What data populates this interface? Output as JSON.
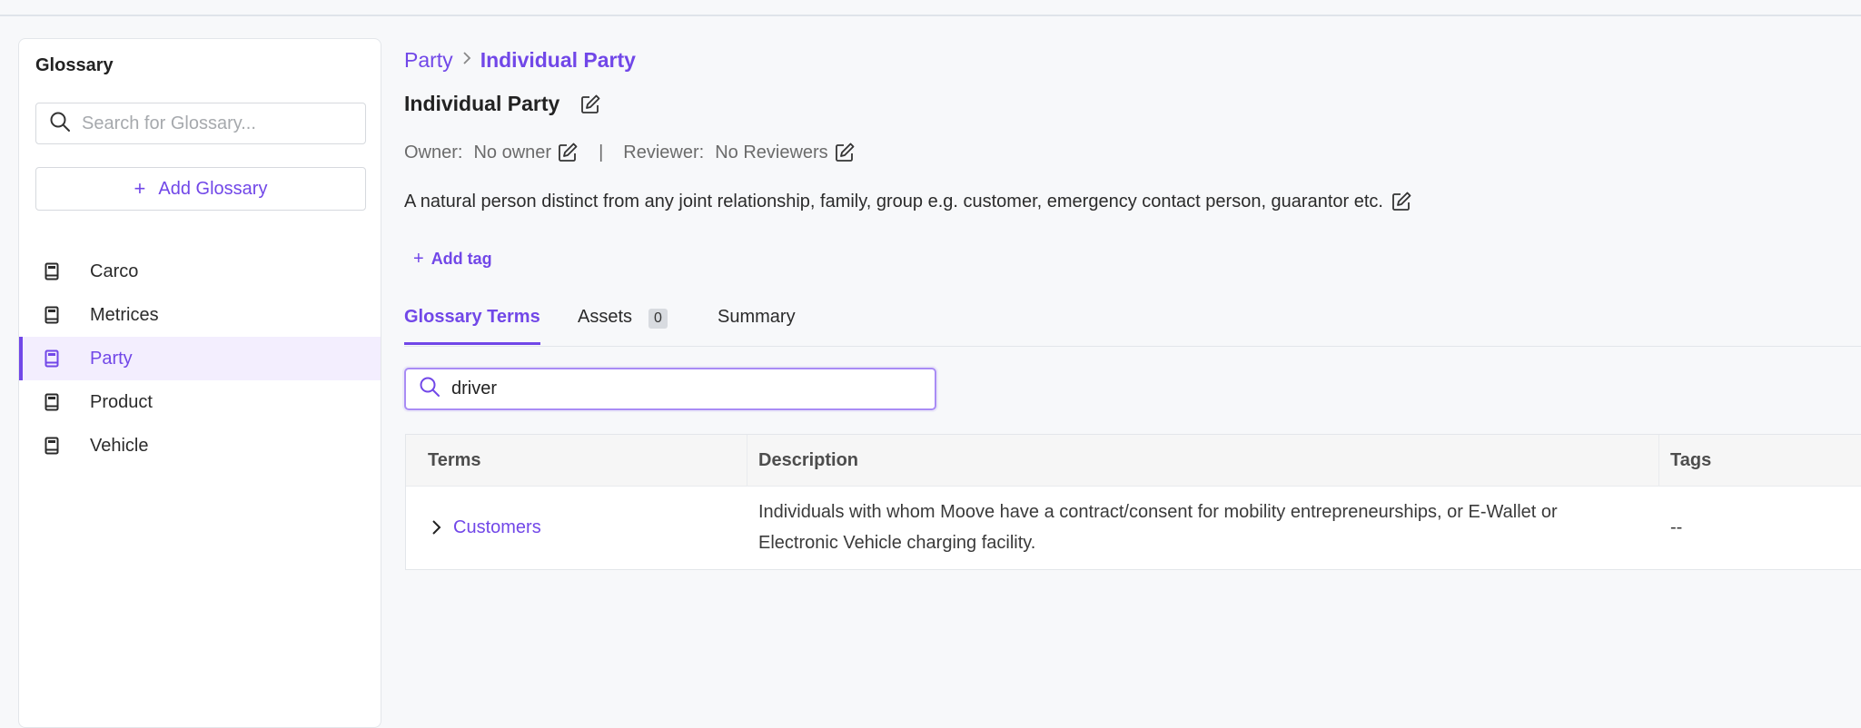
{
  "sidebar": {
    "title": "Glossary",
    "search_placeholder": "Search for Glossary...",
    "add_label": "Add Glossary",
    "items": [
      {
        "label": "Carco",
        "icon": "book-icon"
      },
      {
        "label": "Metrices",
        "icon": "book-icon"
      },
      {
        "label": "Party",
        "icon": "book-icon",
        "active": true
      },
      {
        "label": "Product",
        "icon": "book-icon"
      },
      {
        "label": "Vehicle",
        "icon": "book-icon"
      }
    ]
  },
  "breadcrumb": {
    "parent": "Party",
    "separator": "›",
    "current": "Individual Party"
  },
  "header": {
    "title": "Individual Party",
    "owner_label": "Owner:",
    "owner_value": "No owner",
    "separator": "|",
    "reviewer_label": "Reviewer:",
    "reviewer_value": "No Reviewers",
    "description": "A natural person distinct from any joint relationship, family, group e.g. customer, emergency contact person, guarantor etc.",
    "add_tag": "Add tag"
  },
  "tabs": [
    {
      "label": "Glossary Terms",
      "active": true
    },
    {
      "label": "Assets",
      "count": "0"
    },
    {
      "label": "Summary"
    }
  ],
  "term_search": {
    "value": "driver"
  },
  "table": {
    "columns": [
      "Terms",
      "Description",
      "Tags"
    ],
    "rows": [
      {
        "term": "Customers",
        "description": "Individuals with whom Moove have a contract/consent for mobility entrepreneurships, or E-Wallet or Electronic Vehicle charging facility.",
        "tags": "--"
      }
    ]
  },
  "colors": {
    "accent": "#7147e8",
    "active_bg": "#f3eefe",
    "page_bg": "#f7f8fa"
  }
}
